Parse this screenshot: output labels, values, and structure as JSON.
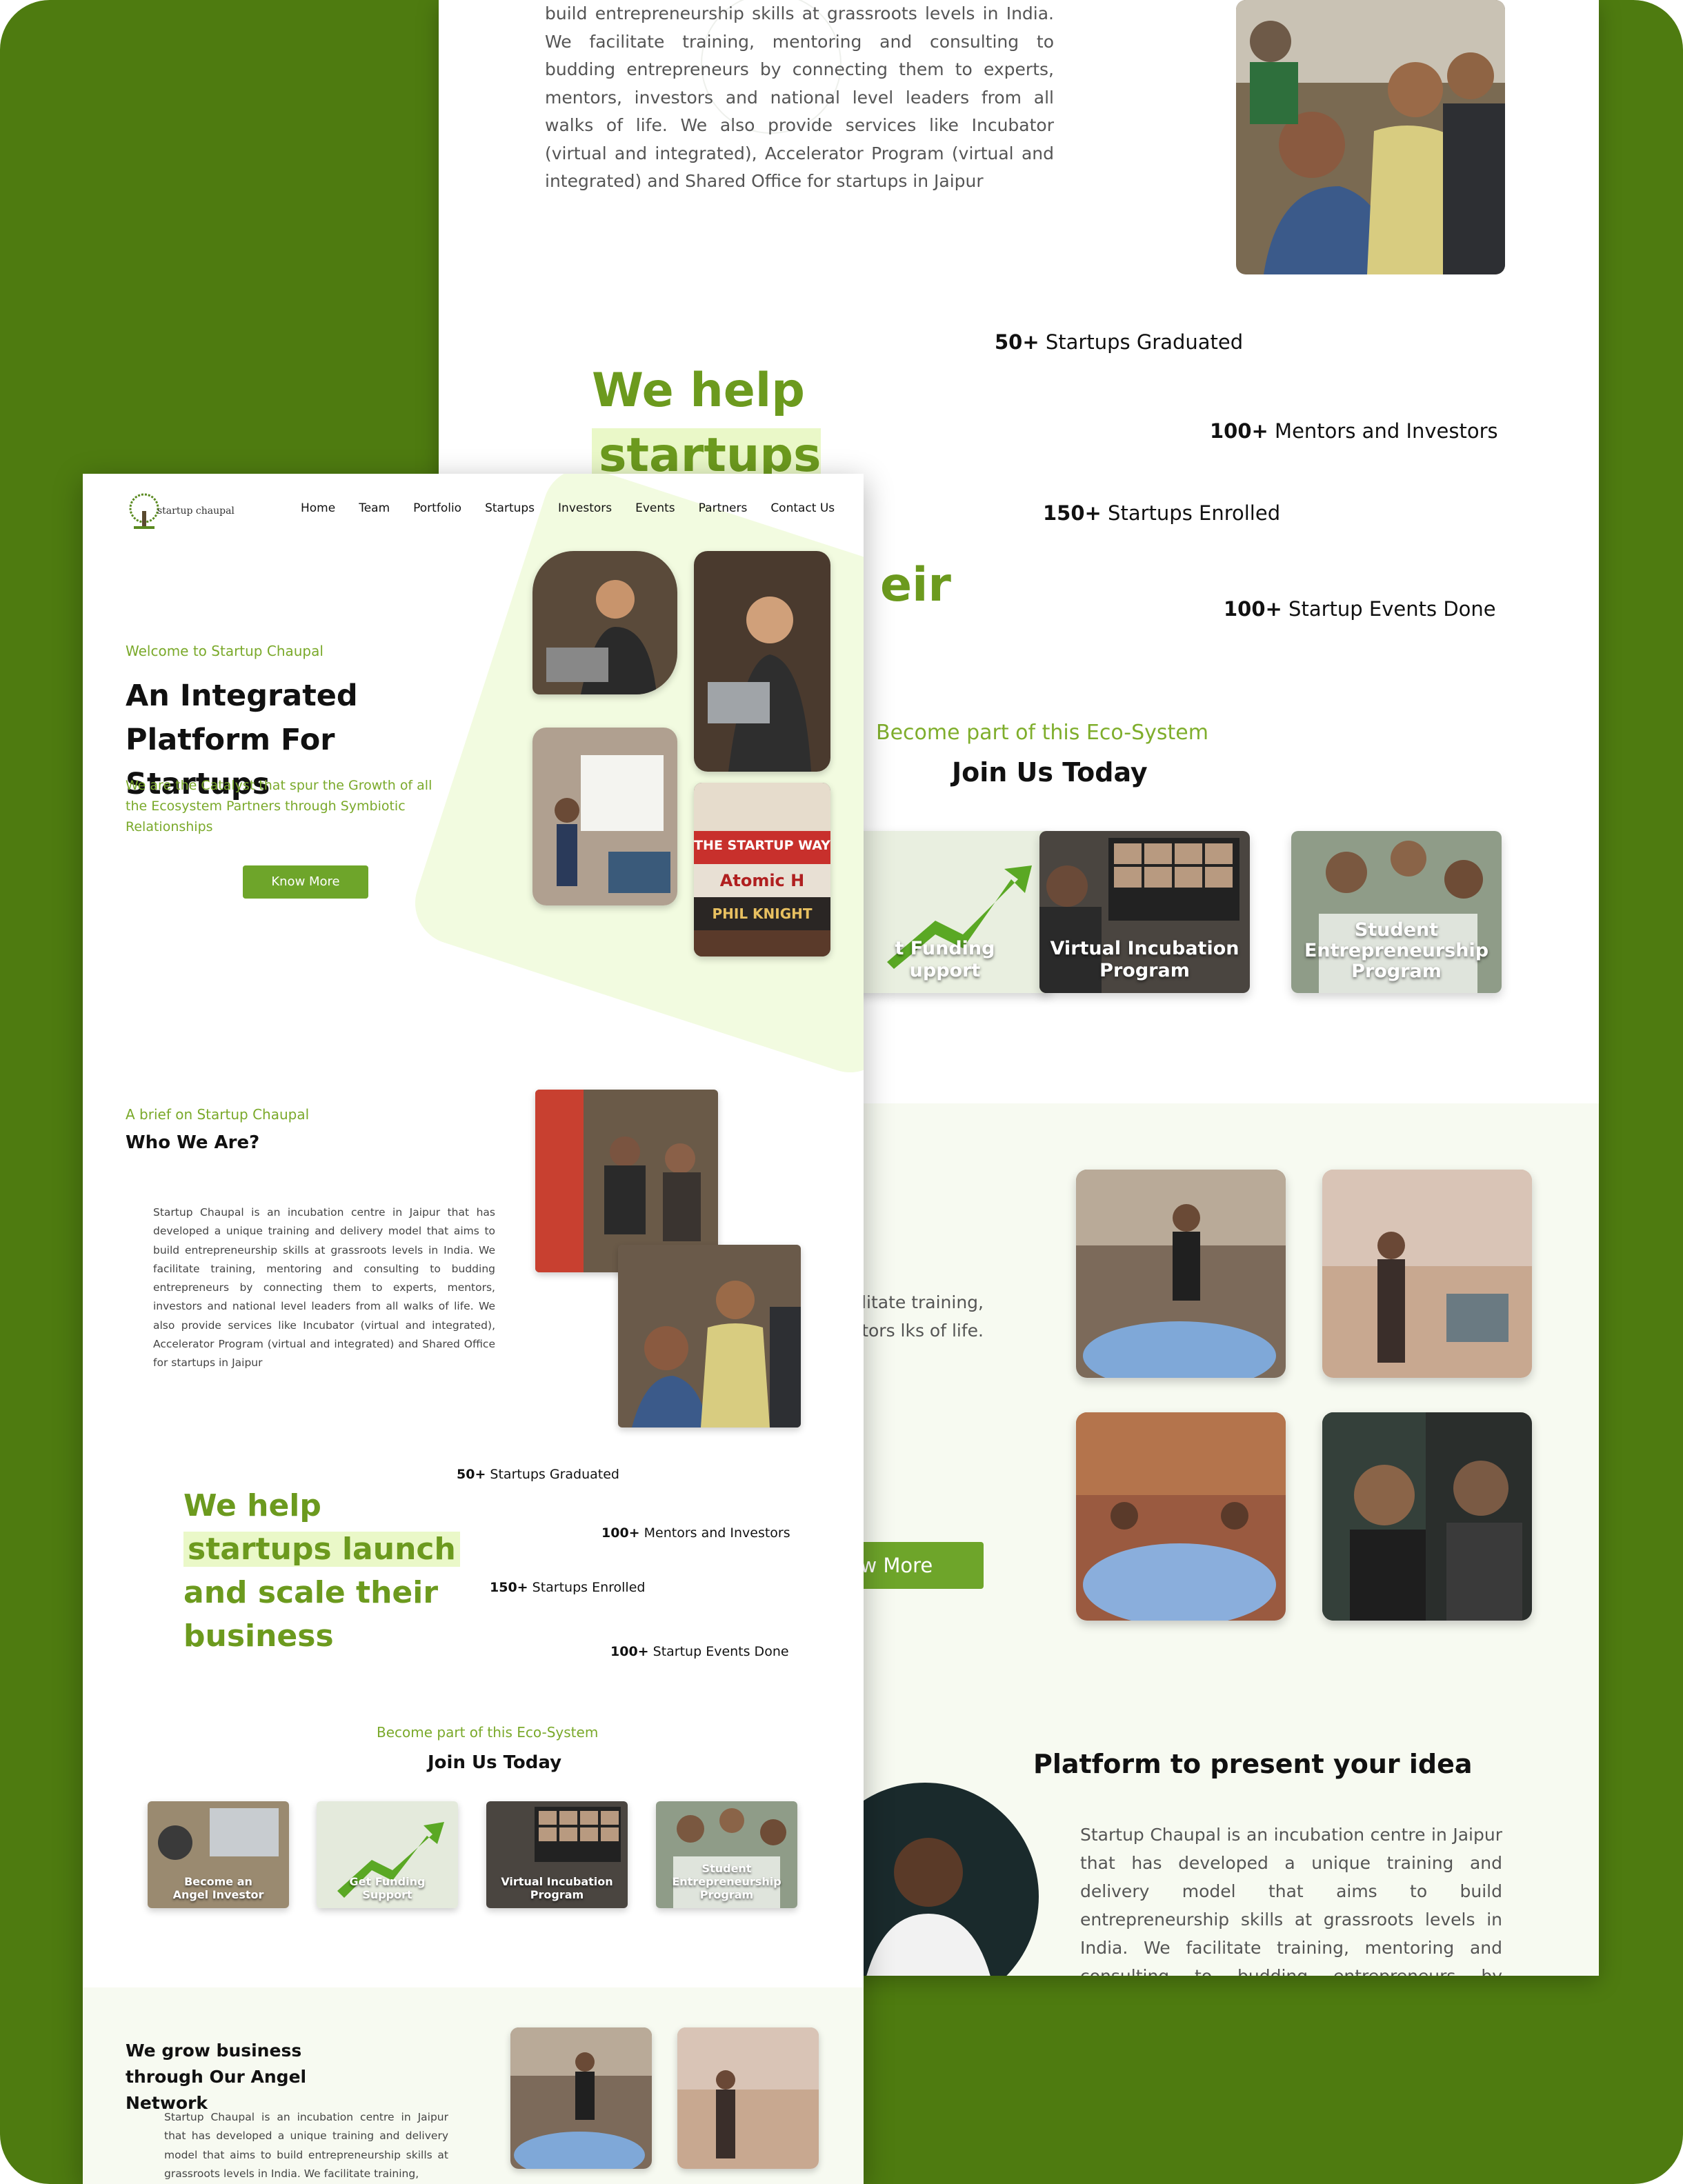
{
  "frame_color": "#4e7b10",
  "accent": "#6ea52a",
  "back_page": {
    "about_text": "build entrepreneurship skills at grassroots levels in India. We facilitate training, mentoring and consulting to budding entrepreneurs by connecting them to experts, mentors, investors and national level leaders from all walks of life. We also provide services like Incubator (virtual and integrated), Accelerator Program (virtual and integrated) and Shared Office for startups in Jaipur",
    "we_help_1": "We help",
    "we_help_2": "startups launch",
    "we_help_3": "eir",
    "stats": [
      {
        "num": "50+",
        "label": " Startups Graduated",
        "ghost": "50"
      },
      {
        "num": "100+",
        "label": " Mentors and Investors",
        "ghost": "100"
      },
      {
        "num": "150+",
        "label": " Startups Enrolled",
        "ghost": "150"
      },
      {
        "num": "100+",
        "label": " Startup Events Done",
        "ghost": "100"
      }
    ],
    "eco_label": "Become part of this Eco-System",
    "join_title": "Join Us Today",
    "cards": [
      {
        "label": "t Funding\nupport"
      },
      {
        "label": "Virtual Incubation\nProgram"
      },
      {
        "label": "Student\nEntrepreneurship\nProgram"
      }
    ],
    "text2": "entre in Jaipur g and delivery urship skills at ilitate training, entrepreneurs ntors, investors lks of life.",
    "know_more": "ow More",
    "platform_title": "Platform to present your idea",
    "platform_text": "Startup Chaupal is an incubation centre in Jaipur that has developed a unique training and delivery model that aims to build entrepreneurship skills at grassroots levels in India. We facilitate training, mentoring and consulting to budding entrepreneurs by connecting them to experts, mentors, investors"
  },
  "front_page": {
    "logo_text": "startup chaupal",
    "nav": [
      "Home",
      "Team",
      "Portfolio",
      "Startups",
      "Investors",
      "Events",
      "Partners",
      "Contact Us"
    ],
    "welcome": "Welcome to Startup Chaupal",
    "hero_title": "An Integrated Platform For Startups",
    "hero_sub": "We are the Catalyst that spur the Growth of all the Ecosystem Partners through Symbiotic Relationships",
    "hero_button": "Know More",
    "book_titles": [
      "THE STARTUP WAY",
      "Atomic H",
      "PHIL KNIGHT"
    ],
    "brief_label": "A brief on Startup Chaupal",
    "who_title": "Who We Are?",
    "who_text": "Startup Chaupal is an incubation centre in Jaipur that has developed a unique training and delivery model that aims to build entrepreneurship skills at grassroots levels in India. We facilitate training, mentoring and consulting to budding entrepreneurs by connecting them to experts, mentors, investors and national level leaders from all walks of life. We also provide services like Incubator (virtual and integrated), Accelerator Program (virtual and integrated) and Shared Office for startups in Jaipur",
    "we_help_1": "We help",
    "we_help_2": "startups launch",
    "we_help_3": "and scale their",
    "we_help_4": "business",
    "stats": [
      {
        "num": "50+",
        "label": " Startups Graduated",
        "ghost": "50"
      },
      {
        "num": "100+",
        "label": " Mentors and Investors",
        "ghost": "100"
      },
      {
        "num": "150+",
        "label": " Startups Enrolled",
        "ghost": "150"
      },
      {
        "num": "100+",
        "label": " Startup Events Done",
        "ghost": "100"
      }
    ],
    "eco_label": "Become part of this Eco-System",
    "join_title": "Join Us Today",
    "cards": [
      {
        "label": "Become an\nAngel Investor"
      },
      {
        "label": "Get Funding\nSupport"
      },
      {
        "label": "Virtual Incubation\nProgram"
      },
      {
        "label": "Student\nEntrepreneurship\nProgram"
      }
    ],
    "angel_title": "We grow business through Our Angel Network",
    "angel_text": "Startup Chaupal is an incubation centre in Jaipur that has developed a unique training and delivery model that aims to build entrepreneurship skills at grassroots levels in India. We facilitate training,"
  }
}
